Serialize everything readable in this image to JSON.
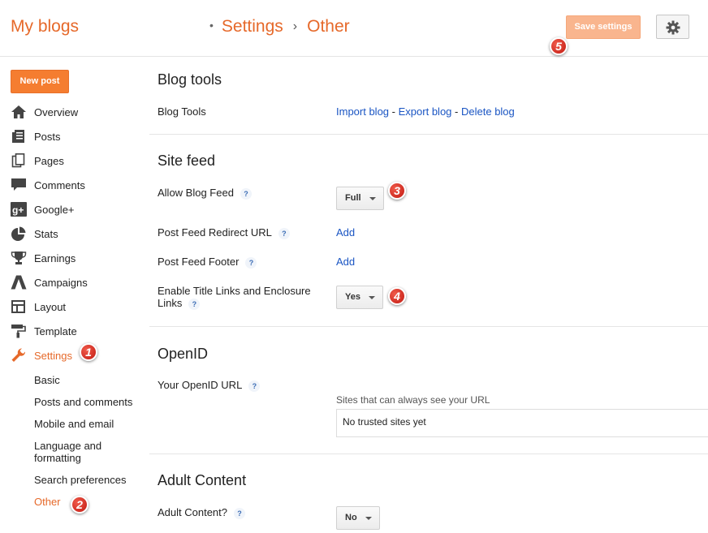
{
  "header": {
    "brand": "My blogs",
    "breadcrumb": {
      "section": "Settings",
      "page": "Other"
    },
    "save_label": "Save settings"
  },
  "sidebar": {
    "new_post": "New post",
    "items": [
      {
        "label": "Overview",
        "icon": "home-icon"
      },
      {
        "label": "Posts",
        "icon": "posts-icon"
      },
      {
        "label": "Pages",
        "icon": "pages-icon"
      },
      {
        "label": "Comments",
        "icon": "comments-icon"
      },
      {
        "label": "Google+",
        "icon": "google-plus-icon"
      },
      {
        "label": "Stats",
        "icon": "stats-icon"
      },
      {
        "label": "Earnings",
        "icon": "trophy-icon"
      },
      {
        "label": "Campaigns",
        "icon": "campaigns-icon"
      },
      {
        "label": "Layout",
        "icon": "layout-icon"
      },
      {
        "label": "Template",
        "icon": "paint-roller-icon"
      },
      {
        "label": "Settings",
        "icon": "wrench-icon",
        "active": true
      }
    ],
    "settings_sub": [
      {
        "label": "Basic"
      },
      {
        "label": "Posts and comments"
      },
      {
        "label": "Mobile and email"
      },
      {
        "label": "Language and formatting"
      },
      {
        "label": "Search preferences"
      },
      {
        "label": "Other",
        "active": true
      }
    ]
  },
  "main": {
    "blog_tools": {
      "title": "Blog tools",
      "row_label": "Blog Tools",
      "import": "Import blog",
      "export": "Export blog",
      "delete": "Delete blog",
      "sep": "-"
    },
    "site_feed": {
      "title": "Site feed",
      "allow_label": "Allow Blog Feed",
      "allow_value": "Full",
      "redirect_label": "Post Feed Redirect URL",
      "redirect_action": "Add",
      "footer_label": "Post Feed Footer",
      "footer_action": "Add",
      "title_links_label": "Enable Title Links and Enclosure Links",
      "title_links_value": "Yes"
    },
    "openid": {
      "title": "OpenID",
      "url_label": "Your OpenID URL",
      "sites_label": "Sites that can always see your URL",
      "sites_value": "No trusted sites yet"
    },
    "adult": {
      "title": "Adult Content",
      "label": "Adult Content?",
      "value": "No"
    },
    "help_mark": "?"
  },
  "badges": [
    "1",
    "2",
    "3",
    "4",
    "5"
  ],
  "colors": {
    "accent": "#e6692a",
    "link": "#1a55c3",
    "badge": "#d8241a"
  }
}
